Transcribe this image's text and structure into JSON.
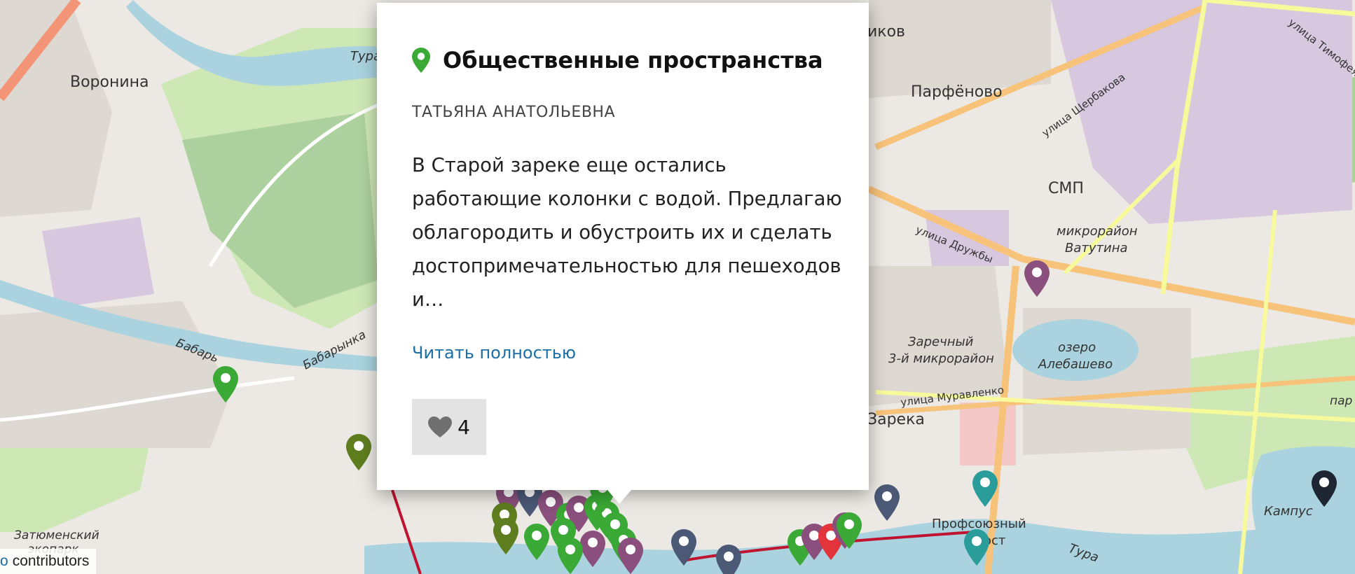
{
  "popup": {
    "category": "Общественные пространства",
    "category_color": "#3aa935",
    "author": "ТАТЬЯНА АНАТОЛЬЕВНА",
    "lines": [
      "В Старой зареке еще остались",
      "работающие колонки с водой. Предлагаю",
      "облагородить и обустроить их и сделать",
      "достопримечательностью для пешеходов",
      "и…"
    ],
    "read_more": "Читать полностью",
    "likes": "4",
    "icons": {
      "category": "map-pin-icon",
      "like": "heart-icon"
    }
  },
  "map": {
    "labels": {
      "voronina": "Воронина",
      "parfenovo": "Парфёново",
      "smp": "СМП",
      "vatutina1": "микрорайон",
      "vatutina2": "Ватутина",
      "zarechny1": "Заречный",
      "zarechny2": "3-й микрорайон",
      "ozero1": "озеро",
      "ozero2": "Алебашево",
      "zareka": "Зарека",
      "profsoyuzny": "Профсоюзный",
      "most": "ост",
      "kampus": "Кампус",
      "ikov": "иков",
      "tura_top": "Тура",
      "tura_bottom": "Тура",
      "babarynka1": "Бабарынка",
      "babarynka2": "Бабарь",
      "zatyumensky1": "Затюменский",
      "zatyumensky2": "экопарк",
      "ul_druzhby": "улица Дружбы",
      "ul_muravlenko": "улица Муравленко",
      "ul_shcherbakova": "улица Щербакова",
      "ul_timofeya": "улица Тимофея Ч",
      "par": "пар"
    },
    "colors": {
      "green": "#3aa935",
      "olive": "#5e7d1f",
      "purple": "#8a4f7d",
      "slate": "#4b5876",
      "teal": "#2a9d9a",
      "red": "#e2343a",
      "dark": "#1e2633"
    }
  },
  "attribution": {
    "link": "o",
    "text": "contributors"
  }
}
